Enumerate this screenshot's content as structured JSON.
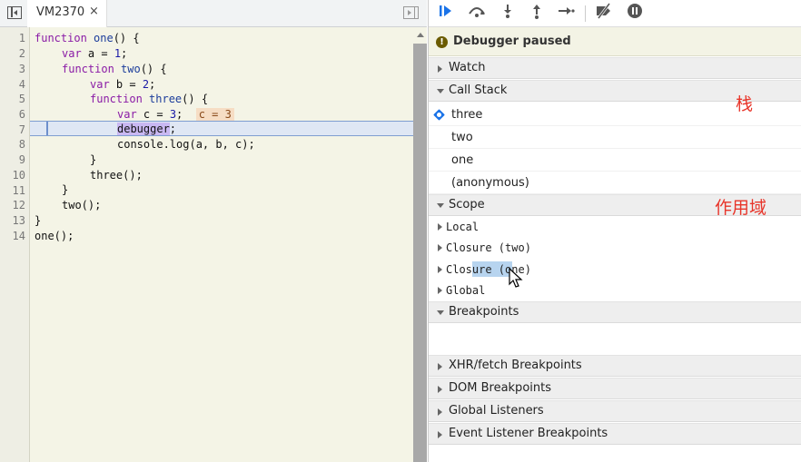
{
  "editor": {
    "tab_label": "VM2370",
    "tab_close": "×",
    "line_numbers": [
      "1",
      "2",
      "3",
      "4",
      "5",
      "6",
      "7",
      "8",
      "9",
      "10",
      "11",
      "12",
      "13",
      "14"
    ],
    "lines": {
      "l1": {
        "kw": "function",
        "name": " one",
        "rest": "() {"
      },
      "l2": {
        "kw": "var",
        "rest": " a = ",
        "num": "1",
        "end": ";"
      },
      "l3": {
        "kw": "function",
        "name": " two",
        "rest": "() {"
      },
      "l4": {
        "kw": "var",
        "rest": " b = ",
        "num": "2",
        "end": ";"
      },
      "l5": {
        "kw": "function",
        "name": " three",
        "rest": "() {"
      },
      "l6": {
        "kw": "var",
        "rest": " c = ",
        "num": "3",
        "end": ";",
        "inline_value": "c = 3"
      },
      "l7": {
        "debugger": "debugger",
        "end": ";"
      },
      "l8": {
        "text": "console.log(a, b, c);"
      },
      "l9": {
        "text": "}"
      },
      "l10": {
        "text": "three();"
      },
      "l11": {
        "text": "}"
      },
      "l12": {
        "text": "two();"
      },
      "l13": {
        "text": "}"
      },
      "l14": {
        "text": "one();"
      }
    }
  },
  "toolbar": {
    "icons": [
      "resume-icon",
      "step-over-icon",
      "step-into-icon",
      "step-out-icon",
      "step-icon",
      "deactivate-breakpoints-icon",
      "pause-on-exceptions-icon"
    ]
  },
  "status": {
    "paused_text": "Debugger paused",
    "paused_icon": "!"
  },
  "sections": {
    "watch": "Watch",
    "call_stack": "Call Stack",
    "scope": "Scope",
    "breakpoints": "Breakpoints",
    "xhr": "XHR/fetch Breakpoints",
    "dom": "DOM Breakpoints",
    "global_listeners": "Global Listeners",
    "event_listener": "Event Listener Breakpoints"
  },
  "call_stack": [
    "three",
    "two",
    "one",
    "(anonymous)"
  ],
  "scope": [
    "Local",
    "Closure (two)",
    "Closure (one)",
    "Global"
  ],
  "annotations": {
    "stack": "栈",
    "scope": "作用域"
  },
  "colors": {
    "annotation": "#e8352a",
    "accent": "#1a73e8"
  }
}
